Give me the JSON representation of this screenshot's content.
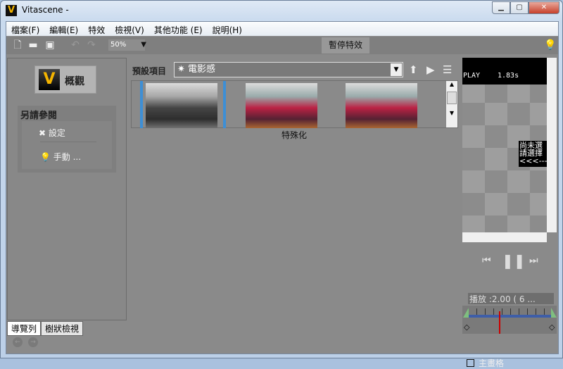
{
  "window": {
    "title": "Vitascene -",
    "logo": "V",
    "buttons": [
      "minimize",
      "maximize",
      "close"
    ]
  },
  "menu": [
    "檔案(F)",
    "編輯(E)",
    "特效",
    "檢視(V)",
    "其他功能 (E)",
    "說明(H)"
  ],
  "toolbar": {
    "zoom": "50%",
    "pause_effect": "暫停特效"
  },
  "left": {
    "overview": "概觀",
    "see_also": "另請參閱",
    "settings": "設定",
    "manual": "手動 ...",
    "tabs": [
      "導覽列",
      "樹狀檢視"
    ]
  },
  "center": {
    "preset_label": "預設項目",
    "preset_value": "電影感",
    "thumb_caption": "特殊化"
  },
  "preview": {
    "status": "PLAY",
    "time": "1.83s",
    "message": [
      "尚未選",
      "請選擇",
      "<<<---"
    ]
  },
  "playback": {
    "label": "播放 :2.00 ( 6 ...",
    "grid_label": "主畫格"
  }
}
